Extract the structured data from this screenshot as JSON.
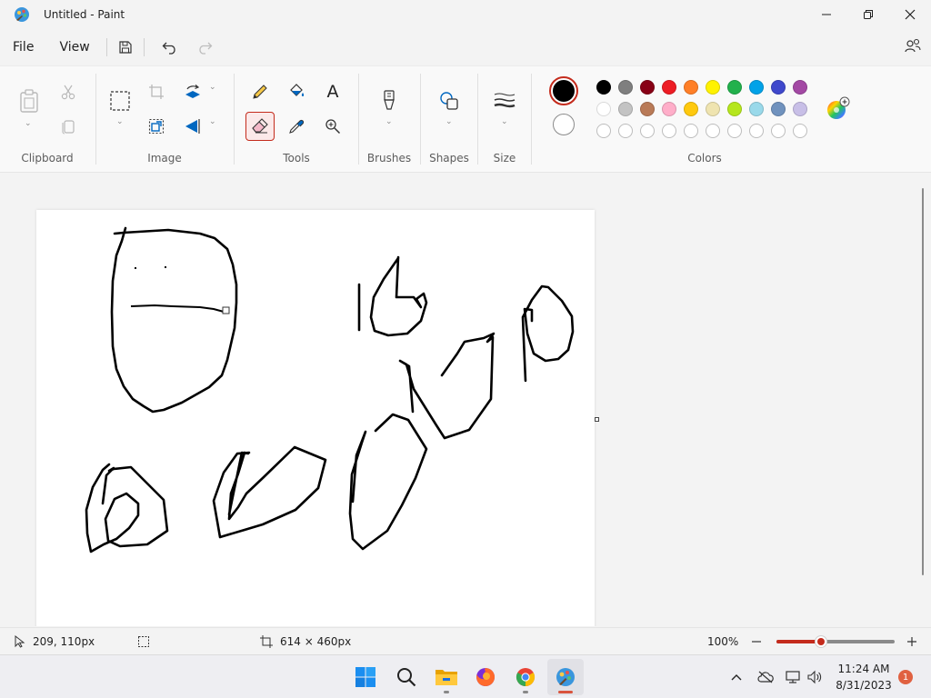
{
  "window": {
    "title": "Untitled - Paint",
    "minimize_icon": "minimize-icon",
    "maximize_icon": "restore-icon",
    "close_icon": "close-icon"
  },
  "menu": {
    "file": "File",
    "view": "View",
    "save_icon": "save-icon",
    "undo_icon": "undo-icon",
    "redo_icon": "redo-icon",
    "share_icon": "share-icon"
  },
  "ribbon": {
    "groups": {
      "clipboard": "Clipboard",
      "image": "Image",
      "tools": "Tools",
      "brushes": "Brushes",
      "shapes": "Shapes",
      "size": "Size",
      "colors": "Colors"
    },
    "text_tool_glyph": "A",
    "selected_tool": "eraser",
    "accent_color": "#c42b1c"
  },
  "colors": {
    "primary": "#000000",
    "secondary": "#ffffff",
    "palette_row1": [
      "#000000",
      "#7f7f7f",
      "#880015",
      "#ed1c24",
      "#ff7f27",
      "#fff200",
      "#22b14c",
      "#00a2e8",
      "#3f48cc",
      "#a349a4"
    ],
    "palette_row2": [
      "#ffffff",
      "#c3c3c3",
      "#b97a57",
      "#ffaec9",
      "#ffc90e",
      "#efe4b0",
      "#b5e61d",
      "#99d9ea",
      "#7092be",
      "#c8bfe7"
    ],
    "palette_row3_empty": 10
  },
  "status": {
    "cursor_position": "209, 110px",
    "canvas_size": "614 × 460px",
    "zoom": "100%",
    "zoom_fraction": 0.38
  },
  "taskbar": {
    "apps": [
      "start",
      "search",
      "file-explorer",
      "firefox",
      "chrome",
      "paint"
    ],
    "active_app": "paint",
    "time": "11:24 AM",
    "date": "8/31/2023",
    "notification_count": "1"
  }
}
